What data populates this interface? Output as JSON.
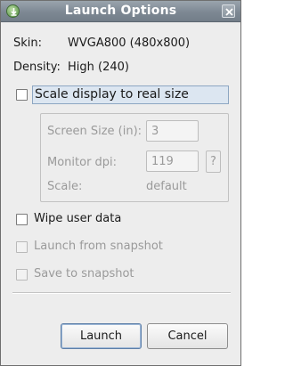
{
  "window": {
    "title": "Launch Options",
    "app_icon": "android-download-icon",
    "close_icon": "close-icon"
  },
  "info": {
    "skin_label": "Skin:",
    "skin_value": "WVGA800 (480x800)",
    "density_label": "Density:",
    "density_value": "High (240)"
  },
  "scale": {
    "label": "Scale display to real size",
    "checked": false,
    "screen_size_label": "Screen Size (in):",
    "screen_size_value": "3",
    "monitor_dpi_label": "Monitor dpi:",
    "monitor_dpi_value": "119",
    "help_label": "?",
    "scale_label": "Scale:",
    "scale_value": "default"
  },
  "options": {
    "wipe_label": "Wipe user data",
    "launch_snapshot_label": "Launch from snapshot",
    "save_snapshot_label": "Save to snapshot"
  },
  "buttons": {
    "launch": "Launch",
    "cancel": "Cancel"
  }
}
